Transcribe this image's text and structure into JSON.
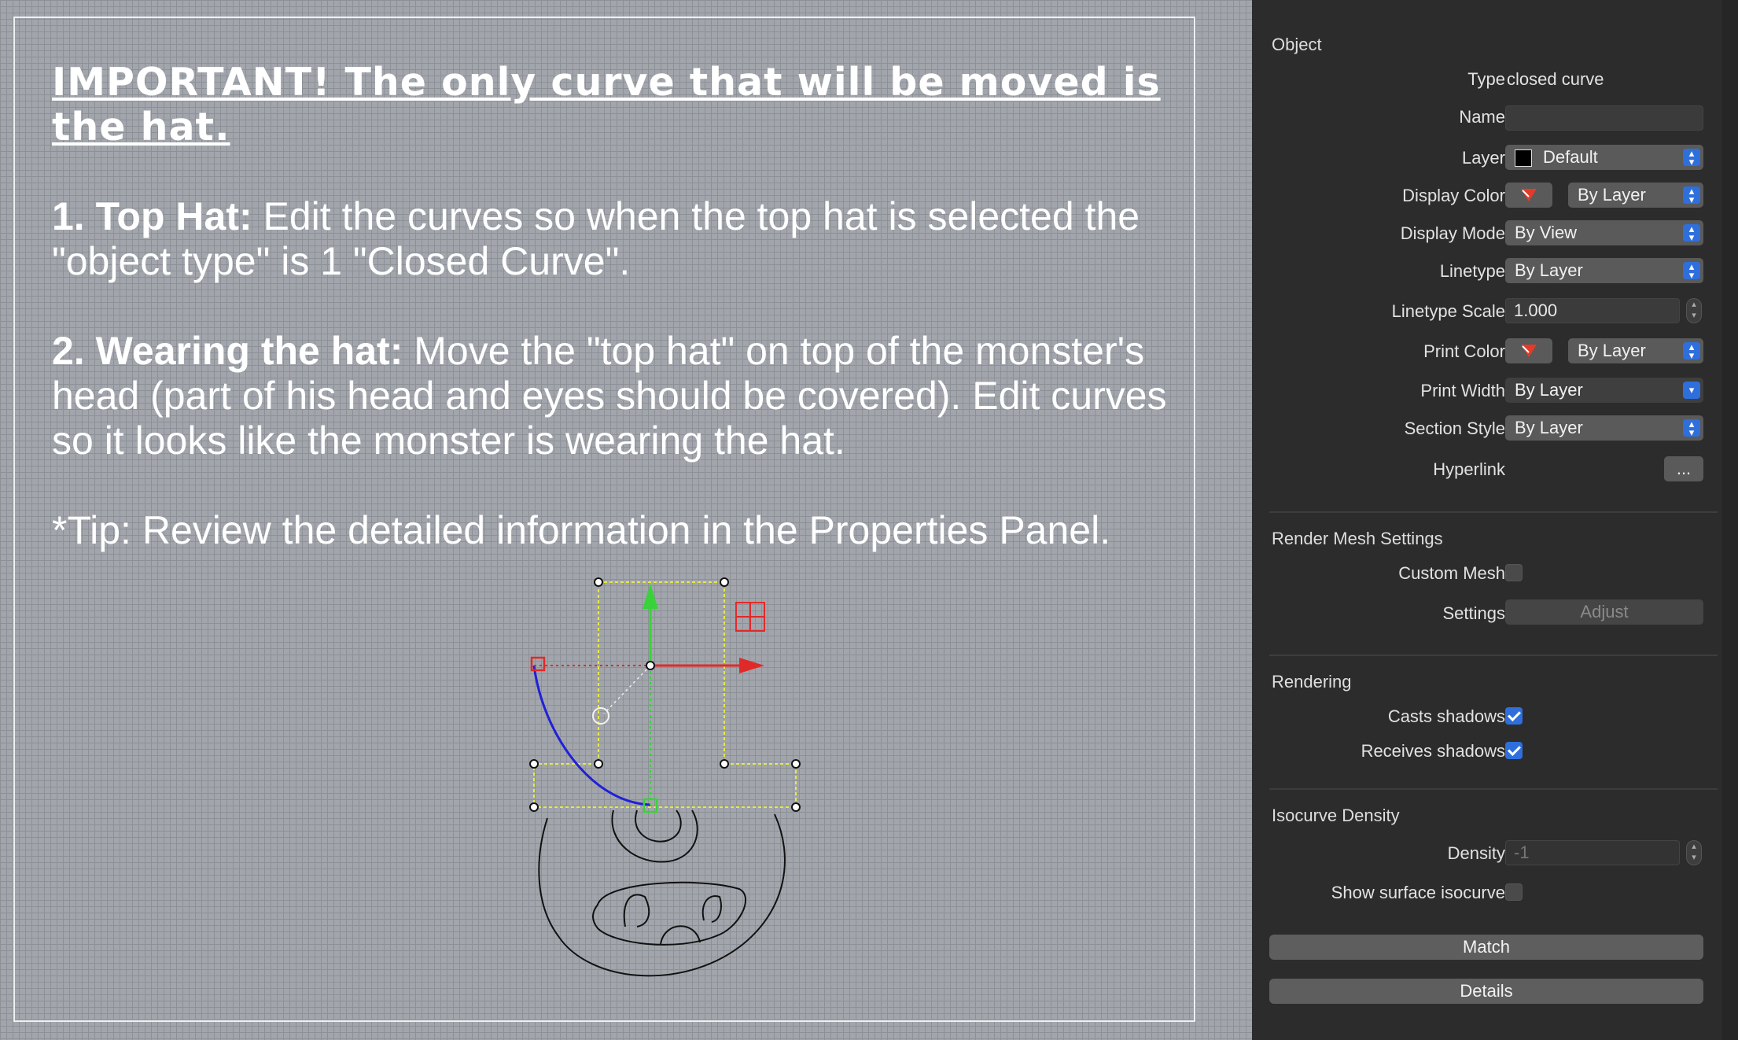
{
  "instructions": {
    "important": "IMPORTANT! The only curve that will be moved is the hat.",
    "step1_lead": "1. Top Hat:",
    "step1_text": " Edit the curves so when the top hat is selected the \"object type\" is 1 \"Closed Curve\".",
    "step2_lead": "2. Wearing the hat:",
    "step2_text": " Move the \"top hat\" on top of the monster's head (part of his head and eyes should be covered). Edit curves so it looks like the monster is wearing the hat.",
    "tip": "*Tip: Review the detailed information in the Properties Panel."
  },
  "panel": {
    "object": {
      "title": "Object",
      "type_label": "Type",
      "type_value": "closed curve",
      "name_label": "Name",
      "name_value": "",
      "layer_label": "Layer",
      "layer_value": "Default",
      "display_color_label": "Display Color",
      "display_color_value": "By Layer",
      "display_mode_label": "Display Mode",
      "display_mode_value": "By View",
      "linetype_label": "Linetype",
      "linetype_value": "By Layer",
      "linetype_scale_label": "Linetype Scale",
      "linetype_scale_value": "1.000",
      "print_color_label": "Print Color",
      "print_color_value": "By Layer",
      "print_width_label": "Print Width",
      "print_width_value": "By Layer",
      "section_style_label": "Section Style",
      "section_style_value": "By Layer",
      "hyperlink_label": "Hyperlink",
      "hyperlink_button": "..."
    },
    "render_mesh": {
      "title": "Render Mesh Settings",
      "custom_mesh_label": "Custom Mesh",
      "custom_mesh_checked": false,
      "settings_label": "Settings",
      "adjust_button": "Adjust"
    },
    "rendering": {
      "title": "Rendering",
      "casts_label": "Casts shadows",
      "casts_checked": true,
      "receives_label": "Receives shadows",
      "receives_checked": true
    },
    "isocurve": {
      "title": "Isocurve Density",
      "density_label": "Density",
      "density_value": "-1",
      "show_surface_label": "Show surface isocurve",
      "show_surface_checked": false
    },
    "match_button": "Match",
    "details_button": "Details"
  },
  "colors": {
    "accent": "#2f6fdc",
    "viewport_bg": "#a2a6ac",
    "panel_bg": "#2c2c2c",
    "selection_yellow": "#e8e84a",
    "arc_blue": "#2020d8",
    "gumball_red": "#e02a2a",
    "gumball_green": "#3ad23a"
  }
}
